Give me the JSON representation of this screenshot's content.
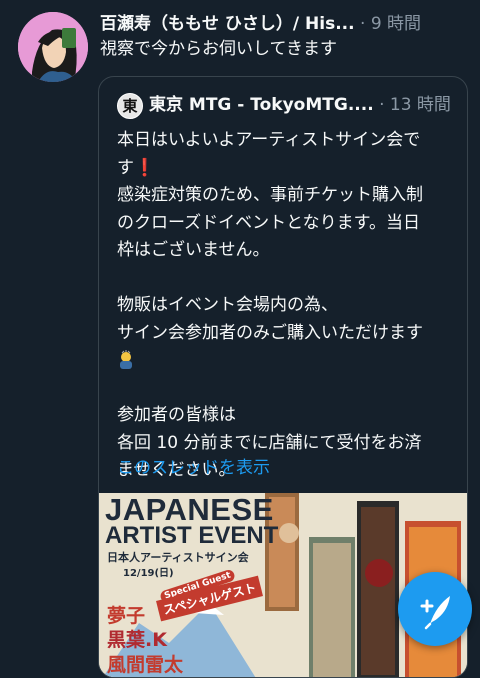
{
  "author": {
    "name": "百瀬寿（ももせ ひさし）/ His...",
    "dot": "·",
    "time": "9 時間"
  },
  "tweet_text": "視察で今からお伺いしてきます",
  "quote": {
    "avatar_char": "東",
    "name": "東京 MTG - TokyoMTG....",
    "dot": "·",
    "time": "13 時間",
    "lines": [
      "本日はいよいよアーティストサイン会で",
      "す",
      "感染症対策のため、事前チケット購入制",
      "のクローズドイベントとなります。当日",
      "枠はございません。",
      "",
      "物販はイベント会場内の為、",
      "サイン会参加者のみご購入いただけます",
      "",
      "",
      "参加者の皆様は",
      "各回 10 分前までに店舗にて受付をお済",
      "ませください。"
    ],
    "exclaim": "❗",
    "thread_link": "このスレッドを表示"
  },
  "event_image": {
    "title1": "JAPANESE",
    "title2": "ARTIST EVENT",
    "subtitle": "日本人アーティストサイン会",
    "date": "12/19(日)",
    "special_guest_en": "Special Guest",
    "special_guest_ja": "スペシャルゲスト",
    "artists": [
      "夢子",
      "黒葉.K",
      "風間雷太"
    ]
  },
  "colors": {
    "background": "#15202b",
    "accent": "#1d9bf0",
    "secondary_text": "#8b98a5"
  },
  "icons": {
    "menu": "more-dots-icon",
    "compose": "compose-feather-icon",
    "emoji": "bowing-person-emoji"
  }
}
